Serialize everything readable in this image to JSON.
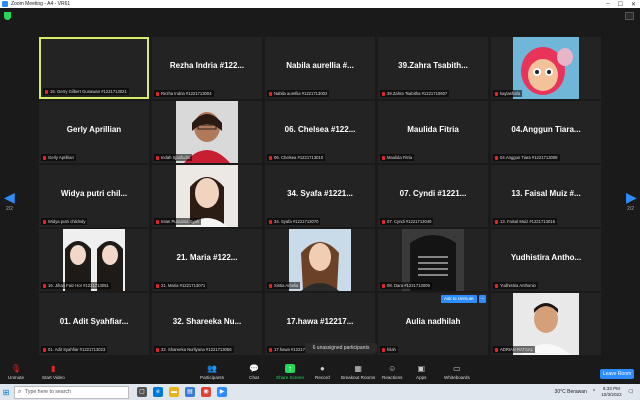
{
  "window": {
    "title": "Zoom Meeting - A4 - VR61"
  },
  "pagination": {
    "left": "2/2",
    "right": "2/2"
  },
  "tiles": [
    {
      "big": "",
      "label": "16. Gerry Gilbert Gunawan #1221713021"
    },
    {
      "big": "Rezha Indria #122...",
      "label": "Rezha Indria #1221713004"
    },
    {
      "big": "Nabila aurellia #...",
      "label": "Nabila aurellia #1221713002"
    },
    {
      "big": "39.Zahra Tsabith...",
      "label": "39.Zahra Tsabitha #1221710607"
    },
    {
      "big": "",
      "label": "kaylashafa"
    },
    {
      "big": "Gerly Aprillian",
      "label": "Gerly Aprillian"
    },
    {
      "big": "",
      "label": "Indah Sjarifudin"
    },
    {
      "big": "06. Chelsea #122...",
      "label": "06. Chelsea #1221713010"
    },
    {
      "big": "Maulida Fitria",
      "label": "Maulida Fitria"
    },
    {
      "big": "04.Anggun Tiara...",
      "label": "04.Anggun Tiara #1221713008"
    },
    {
      "big": "Widya putri chil...",
      "label": "Widya putri childndy"
    },
    {
      "big": "",
      "label": "Intan Purnama Syah"
    },
    {
      "big": "34. Syafa #1221...",
      "label": "34. Syafa #1221713070"
    },
    {
      "big": "07. Cyndi #1221...",
      "label": "07. Cyndi #1221713049"
    },
    {
      "big": "13. Faisal Muiz #...",
      "label": "13. Faisal Muiz #1221713016"
    },
    {
      "big": "",
      "label": "16. Jihan Faiz Hor #1221713051"
    },
    {
      "big": "21. Maria #122...",
      "label": "21. Maria #1221713071"
    },
    {
      "big": "",
      "label": "Sintia Amelia"
    },
    {
      "big": "",
      "label": "08. Dara #1221713009"
    },
    {
      "big": "Yudhistira Antho...",
      "label": "Yudhistira Anthonio"
    },
    {
      "big": "01. Adit Syahfiar...",
      "label": "01. Adit Syahfiar #1221713023"
    },
    {
      "big": "32. Shareeka Nu...",
      "label": "32. Shareeka Nurliyana #1221713056"
    },
    {
      "big": "17.hawa #12217...",
      "label": "17.hawa #1221713"
    },
    {
      "big": "Aulia nadhilah",
      "label": "hilah"
    },
    {
      "big": "",
      "label": "ADRIAN RATSAL"
    }
  ],
  "ask_to_unmute": "Ask to Unmute",
  "ask_more": "...",
  "unassigned": "6 unassigned participants",
  "toolbar": {
    "unmute": "Unmute",
    "start_video": "Start Video",
    "participants": "Participants",
    "participants_count": "31",
    "chat": "Chat",
    "share_screen": "Share Screen",
    "record": "Record",
    "breakout_rooms": "Breakout Rooms",
    "reactions": "Reactions",
    "apps": "Apps",
    "whiteboards": "Whiteboards",
    "leave_room": "Leave Room"
  },
  "taskbar": {
    "search_placeholder": "Type here to search",
    "weather": "30°C  Berawan",
    "time": "6:33 PM",
    "date": "10/3/2022"
  },
  "colors": {
    "accent": "#2D8CFF",
    "active_border": "#d9e96a",
    "muted_mic": "#e02828",
    "share_green": "#23d959"
  }
}
